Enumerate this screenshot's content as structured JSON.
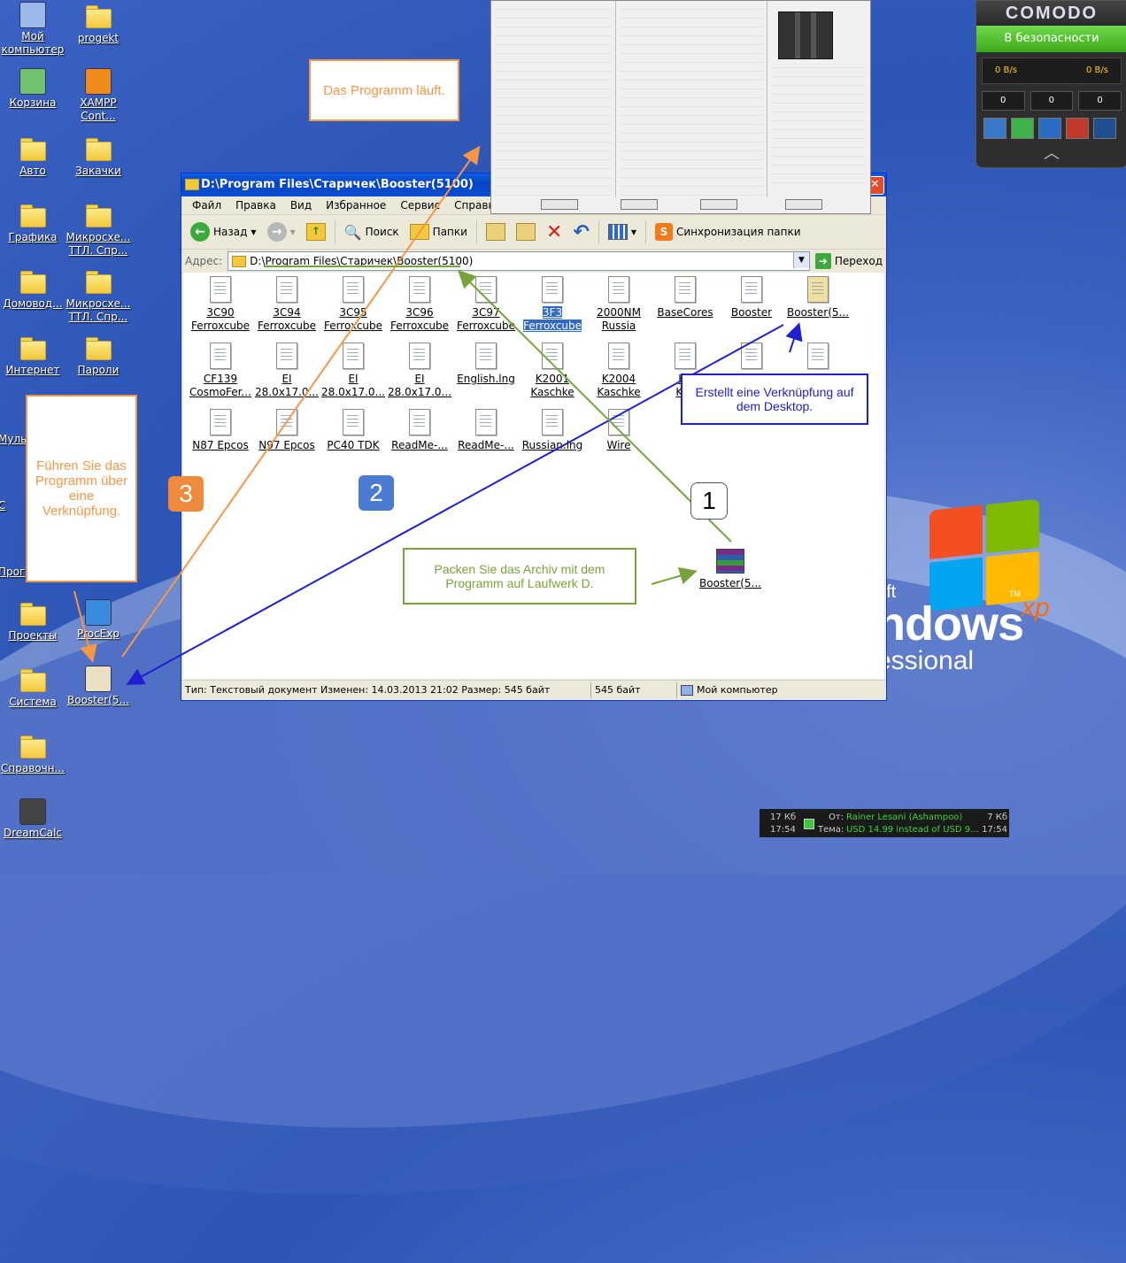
{
  "desktop": {
    "icons": [
      {
        "label": "Мой компьютер",
        "name": "my-computer-icon"
      },
      {
        "label": "progekt",
        "name": "folder-icon"
      },
      {
        "label": "Корзина",
        "name": "recycle-bin-icon"
      },
      {
        "label": "XAMPP Cont...",
        "name": "xampp-icon"
      },
      {
        "label": "Авто",
        "name": "folder-icon"
      },
      {
        "label": "Закачки",
        "name": "folder-icon"
      },
      {
        "label": "Графика",
        "name": "folder-icon"
      },
      {
        "label": "Микросхе... ТТЛ. Спр...",
        "name": "folder-icon"
      },
      {
        "label": "Домовод...",
        "name": "folder-icon"
      },
      {
        "label": "Микросхе... ТТЛ. Спр...",
        "name": "folder-icon"
      },
      {
        "label": "Интернет",
        "name": "folder-icon"
      },
      {
        "label": "Пароли",
        "name": "folder-icon"
      },
      {
        "label": "Проекты",
        "name": "folder-icon"
      },
      {
        "label": "ProcExp",
        "name": "procexp-icon"
      },
      {
        "label": "Система",
        "name": "folder-icon"
      },
      {
        "label": "Booster(5...",
        "name": "booster-shortcut-icon"
      },
      {
        "label": "Справочн...",
        "name": "folder-icon"
      },
      {
        "label": "DreamCalc",
        "name": "calculator-icon"
      }
    ],
    "partial_labels": [
      "Муль",
      "С",
      "Прог"
    ],
    "winxp_logo": {
      "brand_partial": "oft",
      "word": "ndows",
      "sup": "xp",
      "edition": "essional",
      "tm": "TM"
    }
  },
  "explorer": {
    "title": "D:\\Program Files\\Старичек\\Booster(5100)",
    "menu": [
      "Файл",
      "Правка",
      "Вид",
      "Избранное",
      "Сервис",
      "Справка"
    ],
    "toolbar": {
      "back": "Назад",
      "search": "Поиск",
      "folders": "Папки",
      "sync": "Синхронизация папки"
    },
    "address_label": "Адрес:",
    "address": "D:\\Program Files\\Старичек\\Booster(5100)",
    "go": "Переход",
    "files": [
      [
        "3C90",
        "Ferroxcube"
      ],
      [
        "3C94",
        "Ferroxcube"
      ],
      [
        "3C95",
        "Ferroxcube"
      ],
      [
        "3C96",
        "Ferroxcube"
      ],
      [
        "3C97",
        "Ferroxcube"
      ],
      [
        "3F3",
        "Ferroxcube"
      ],
      [
        "2000NM",
        "Russia"
      ],
      [
        "BaseCores",
        ""
      ],
      [
        "Booster",
        ""
      ],
      [
        "Booster(5...",
        ""
      ],
      [
        "CF139",
        "CosmoFer..."
      ],
      [
        "EI",
        "28.0x17.0..."
      ],
      [
        "EI",
        "28.0x17.0..."
      ],
      [
        "EI",
        "28.0x17.0..."
      ],
      [
        "English.lng",
        ""
      ],
      [
        "K2001",
        "Kaschke"
      ],
      [
        "K2004",
        "Kaschke"
      ],
      [
        "K2",
        "Kas"
      ],
      [
        "",
        ""
      ],
      [
        "",
        ""
      ],
      [
        "N87 Epcos",
        ""
      ],
      [
        "N97 Epcos",
        ""
      ],
      [
        "PC40 TDK",
        ""
      ],
      [
        "ReadMe-...",
        ""
      ],
      [
        "ReadMe-...",
        ""
      ],
      [
        "Russian.lng",
        ""
      ],
      [
        "Wire",
        ""
      ]
    ],
    "archive_label": "Booster(5...",
    "status": {
      "info": "Тип: Текстовый документ Изменен: 14.03.2013 21:02 Размер: 545 байт",
      "size": "545 байт",
      "location": "Мой компьютер"
    }
  },
  "annotations": {
    "running": "Das Programm läuft.",
    "shortcut_created": "Erstellt eine Verknüpfung auf dem Desktop.",
    "run_via_shortcut": "Führen Sie das Programm über eine Verknüpfung.",
    "unpack": "Packen Sie das Archiv mit dem Programm auf Laufwerk D.",
    "badge1": "1",
    "badge2": "2",
    "badge3": "3"
  },
  "comodo": {
    "title": "COMODO",
    "status": "В безопасности",
    "down": "0 B/s",
    "up": "0 B/s",
    "counters": [
      "0",
      "0",
      "0"
    ]
  },
  "tray": {
    "l1a": "17 Кб",
    "l2a": "17:54",
    "from_label": "От:",
    "from": "Rainer Lesani (Ashampoo)",
    "r1": "7 Кб",
    "topic_label": "Тема:",
    "topic": "USD 14.99 instead of USD 9...",
    "r2": "17:54"
  },
  "colors": {
    "orange": "#f79646",
    "blue": "#1f1fd0",
    "green": "#77a33a",
    "badge_blue": "#4a7bd3",
    "badge_orange": "#ef8a3c",
    "comodo_green": "#4fbf2a"
  }
}
